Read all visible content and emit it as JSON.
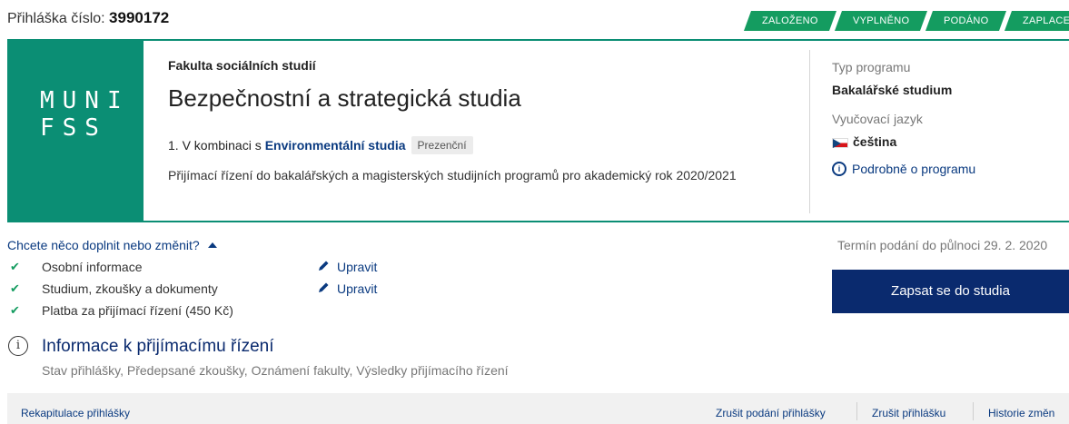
{
  "application": {
    "label": "Přihláška číslo:",
    "number": "3990172"
  },
  "status_steps": [
    "ZALOŽENO",
    "VYPLNĚNO",
    "PODÁNO",
    "ZAPLACENO"
  ],
  "program": {
    "logo_text": "MUNI\nFSS",
    "faculty": "Fakulta sociálních studií",
    "title": "Bezpečnostní a strategická studia",
    "combination_prefix": "1. V kombinaci s",
    "combination_link": "Environmentální studia",
    "study_form": "Prezenční",
    "admission": "Přijímací řízení do bakalářských a magisterských studijních programů pro akademický rok 2020/2021",
    "type_label": "Typ programu",
    "type_value": "Bakalářské studium",
    "language_label": "Vyučovací jazyk",
    "language_value": "čeština",
    "detail_link": "Podrobně o programu"
  },
  "checklist": {
    "toggle_label": "Chcete něco doplnit nebo změnit?",
    "items": [
      {
        "label": "Osobní informace",
        "action": "Upravit"
      },
      {
        "label": "Studium, zkoušky a dokumenty",
        "action": "Upravit"
      },
      {
        "label": "Platba za přijímací řízení (450 Kč)"
      }
    ]
  },
  "actions": {
    "deadline": "Termín podání do půlnoci 29. 2. 2020",
    "enroll_button": "Zapsat se do studia"
  },
  "info": {
    "title": "Informace k přijímacímu řízení",
    "subtitle": "Stav přihlášky, Předepsané zkoušky, Oznámení fakulty, Výsledky přijímacího řízení"
  },
  "footer": {
    "recap": "Rekapitulace přihlášky",
    "cancel_submission": "Zrušit podání přihlášky",
    "cancel_application": "Zrušit přihlášku",
    "history": "Historie změn"
  },
  "colors": {
    "accent": "#0b8e74",
    "step": "#149c60",
    "primary_button": "#0a2a6e",
    "link": "#0a3a80"
  }
}
